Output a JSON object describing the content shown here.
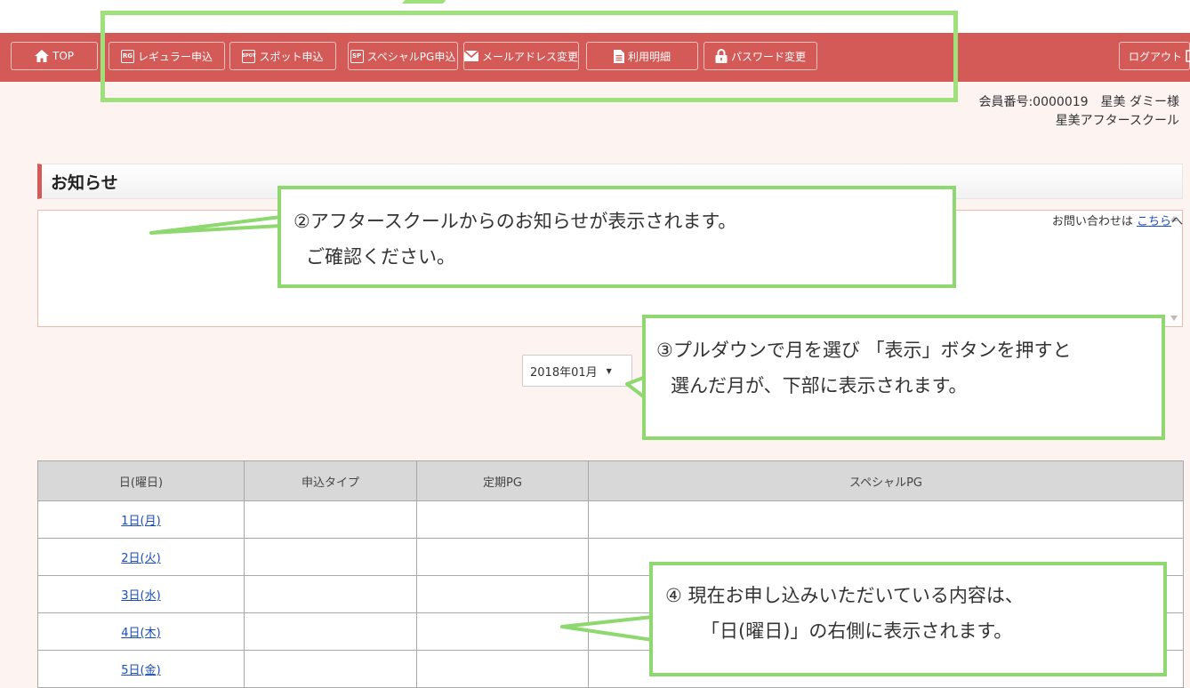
{
  "nav": {
    "top": "TOP",
    "regular": "レギュラー申込",
    "regular_badge": "RG",
    "spot": "スポット申込",
    "spot_badge": "SPOT",
    "special": "スペシャルPG申込",
    "special_badge": "SP",
    "email": "メールアドレス変更",
    "statement": "利用明細",
    "password": "パスワード変更",
    "logout": "ログアウト"
  },
  "member": {
    "line1": "会員番号:0000019　星美 ダミー様",
    "line2": "星美アフタースクール"
  },
  "notice": {
    "title": "お知らせ",
    "contact_prefix": "お問い合わせは ",
    "contact_link": "こちら",
    "contact_suffix": "へ"
  },
  "month_select": {
    "value": "2018年01月"
  },
  "table": {
    "headers": [
      "日(曜日)",
      "申込タイプ",
      "定期PG",
      "スペシャルPG"
    ],
    "rows": [
      "1日(月)",
      "2日(火)",
      "3日(水)",
      "4日(木)",
      "5日(金)"
    ]
  },
  "callouts": {
    "c2_line1": "②アフタースクールからのお知らせが表示されます。",
    "c2_line2": "ご確認ください。",
    "c3_line1": "③プルダウンで月を選び 「表示」ボタンを押すと",
    "c3_line2": "選んだ月が、下部に表示されます。",
    "c4_line1": "④  現在お申し込みいただいている内容は、",
    "c4_line2": "「日(曜日)」の右側に表示されます。"
  },
  "colors": {
    "header": "#d35a56",
    "callout_border": "#8ed86f",
    "link": "#1a4db8",
    "page_bg": "#fdf3f0"
  }
}
